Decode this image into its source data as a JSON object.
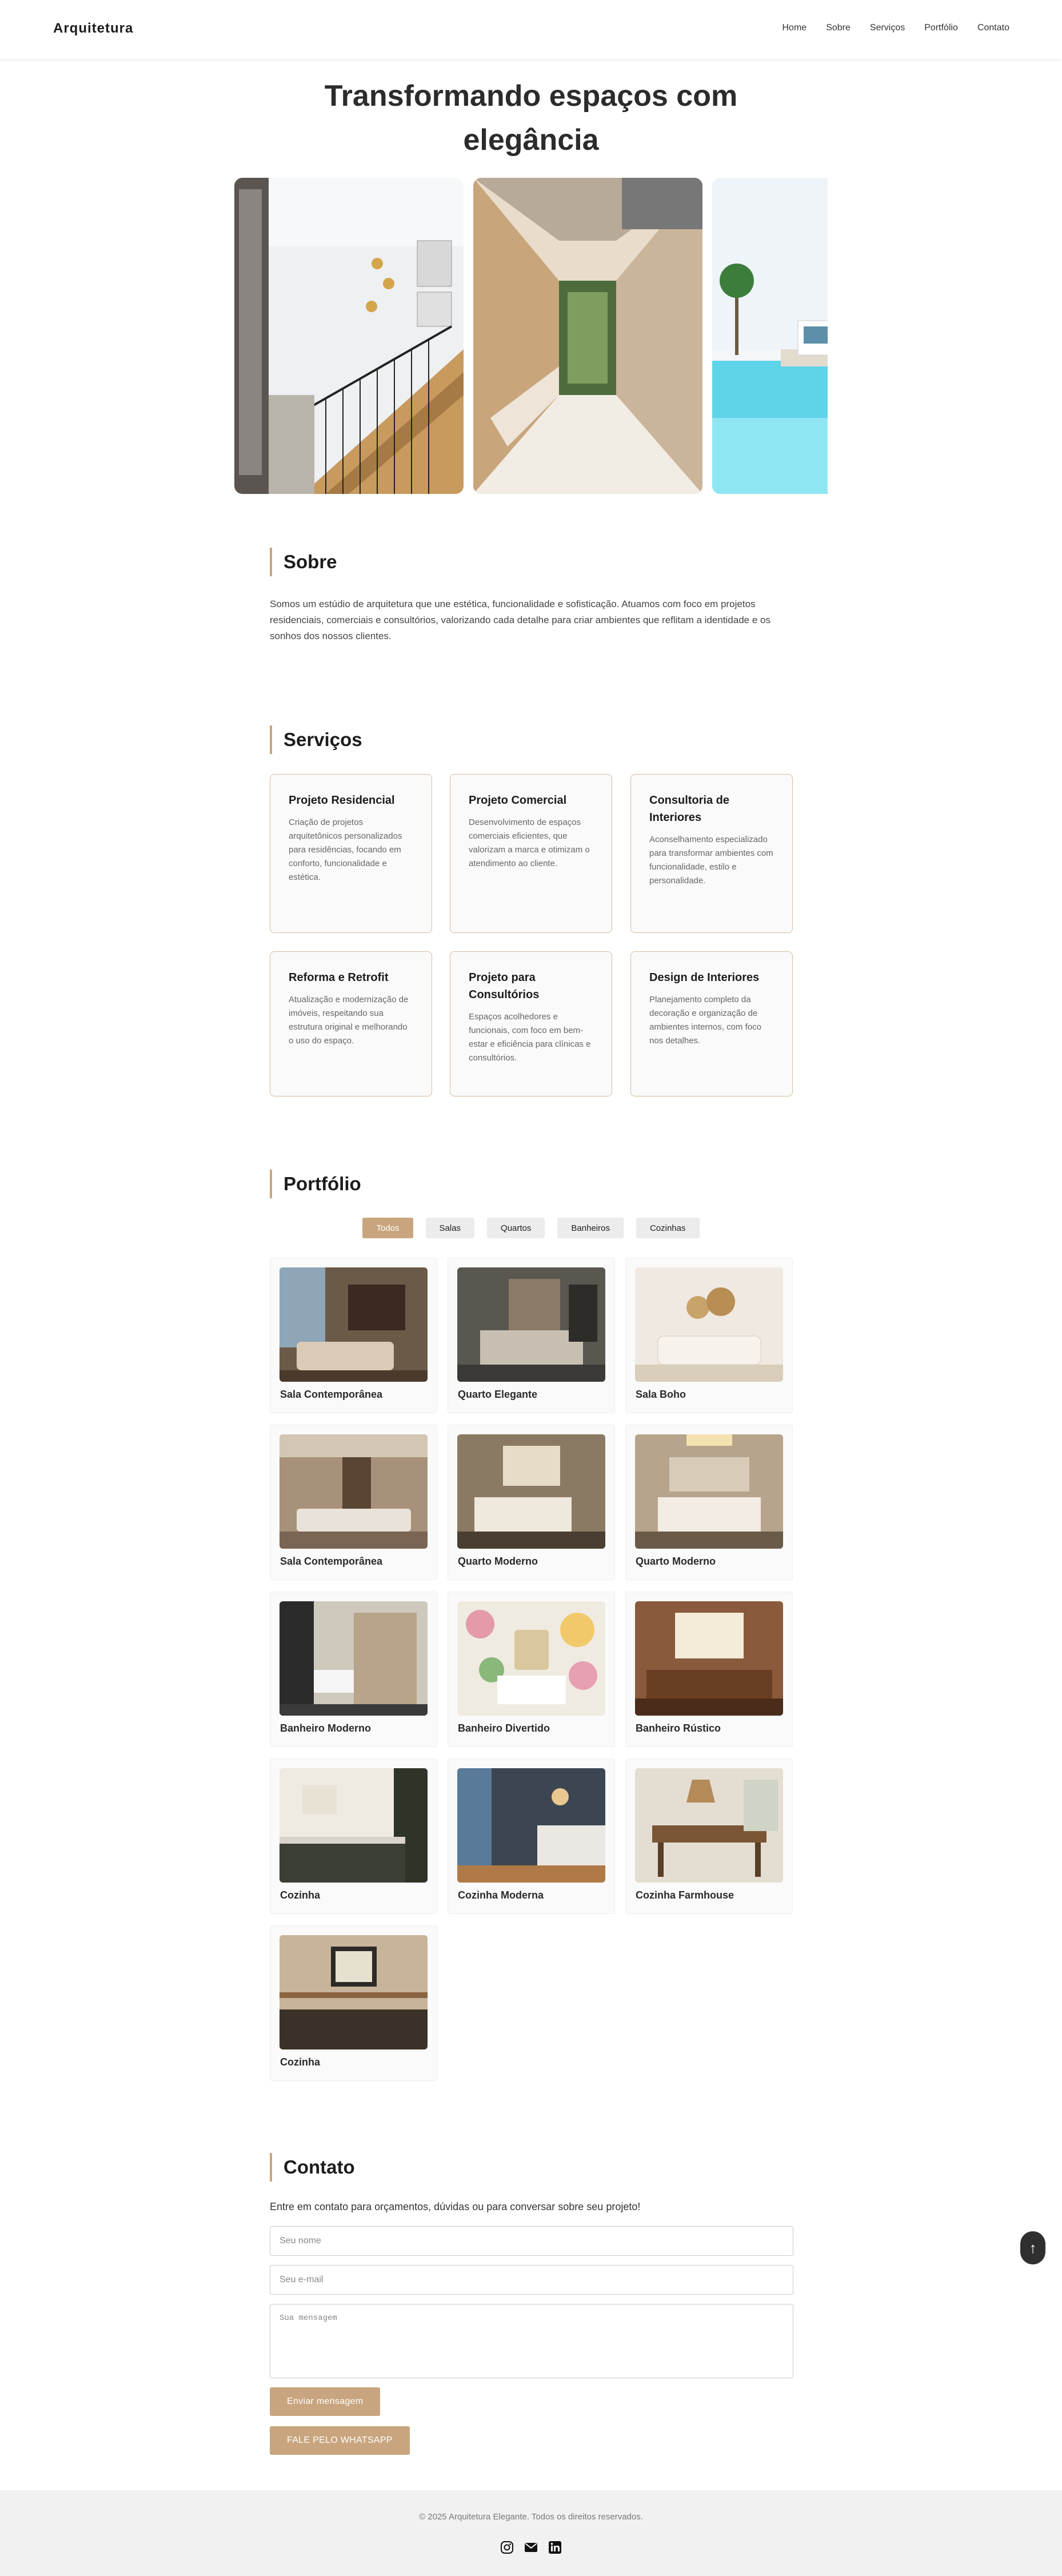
{
  "header": {
    "logo": "Arquitetura",
    "nav": [
      "Home",
      "Sobre",
      "Serviços",
      "Portfólio",
      "Contato"
    ]
  },
  "hero": {
    "title": "Transformando espaços com elegância"
  },
  "about": {
    "title": "Sobre",
    "text": "Somos um estúdio de arquitetura que une estética, funcionalidade e sofisticação. Atuamos com foco em projetos residenciais, comerciais e consultórios, valorizando cada detalhe para criar ambientes que reflitam a identidade e os sonhos dos nossos clientes."
  },
  "services": {
    "title": "Serviços",
    "items": [
      {
        "title": "Projeto Residencial",
        "text": "Criação de projetos arquitetônicos personalizados para residências, focando em conforto, funcionalidade e estética."
      },
      {
        "title": "Projeto Comercial",
        "text": "Desenvolvimento de espaços comerciais eficientes, que valorizam a marca e otimizam o atendimento ao cliente."
      },
      {
        "title": "Consultoria de Interiores",
        "text": "Aconselhamento especializado para transformar ambientes com funcionalidade, estilo e personalidade."
      },
      {
        "title": "Reforma e Retrofit",
        "text": "Atualização e modernização de imóveis, respeitando sua estrutura original e melhorando o uso do espaço."
      },
      {
        "title": "Projeto para Consultórios",
        "text": "Espaços acolhedores e funcionais, com foco em bem-estar e eficiência para clínicas e consultórios."
      },
      {
        "title": "Design de Interiores",
        "text": "Planejamento completo da decoração e organização de ambientes internos, com foco nos detalhes."
      }
    ]
  },
  "portfolio": {
    "title": "Portfólio",
    "filters": [
      "Todos",
      "Salas",
      "Quartos",
      "Banheiros",
      "Cozinhas"
    ],
    "active_filter": "Todos",
    "items": [
      {
        "caption": "Sala Contemporânea"
      },
      {
        "caption": "Quarto Elegante"
      },
      {
        "caption": "Sala Boho"
      },
      {
        "caption": "Sala Contemporânea"
      },
      {
        "caption": "Quarto Moderno"
      },
      {
        "caption": "Quarto Moderno"
      },
      {
        "caption": "Banheiro Moderno"
      },
      {
        "caption": "Banheiro Divertido"
      },
      {
        "caption": "Banheiro Rústico"
      },
      {
        "caption": "Cozinha"
      },
      {
        "caption": "Cozinha Moderna"
      },
      {
        "caption": "Cozinha Farmhouse"
      },
      {
        "caption": "Cozinha"
      }
    ]
  },
  "contact": {
    "title": "Contato",
    "intro": "Entre em contato para orçamentos, dúvidas ou para conversar sobre seu projeto!",
    "name_placeholder": "Seu nome",
    "email_placeholder": "Seu e-mail",
    "message_placeholder": "Sua mensagem",
    "submit_label": "Enviar mensagem",
    "whatsapp_label": "FALE PELO WHATSAPP"
  },
  "footer": {
    "copyright": "© 2025 Arquitetura Elegante. Todos os direitos reservados.",
    "social_icons": [
      "instagram-icon",
      "email-icon",
      "linkedin-icon"
    ]
  },
  "scroll_top_label": "↑",
  "colors": {
    "accent": "#c8a57e",
    "footer_bg": "#f1f1f1"
  }
}
